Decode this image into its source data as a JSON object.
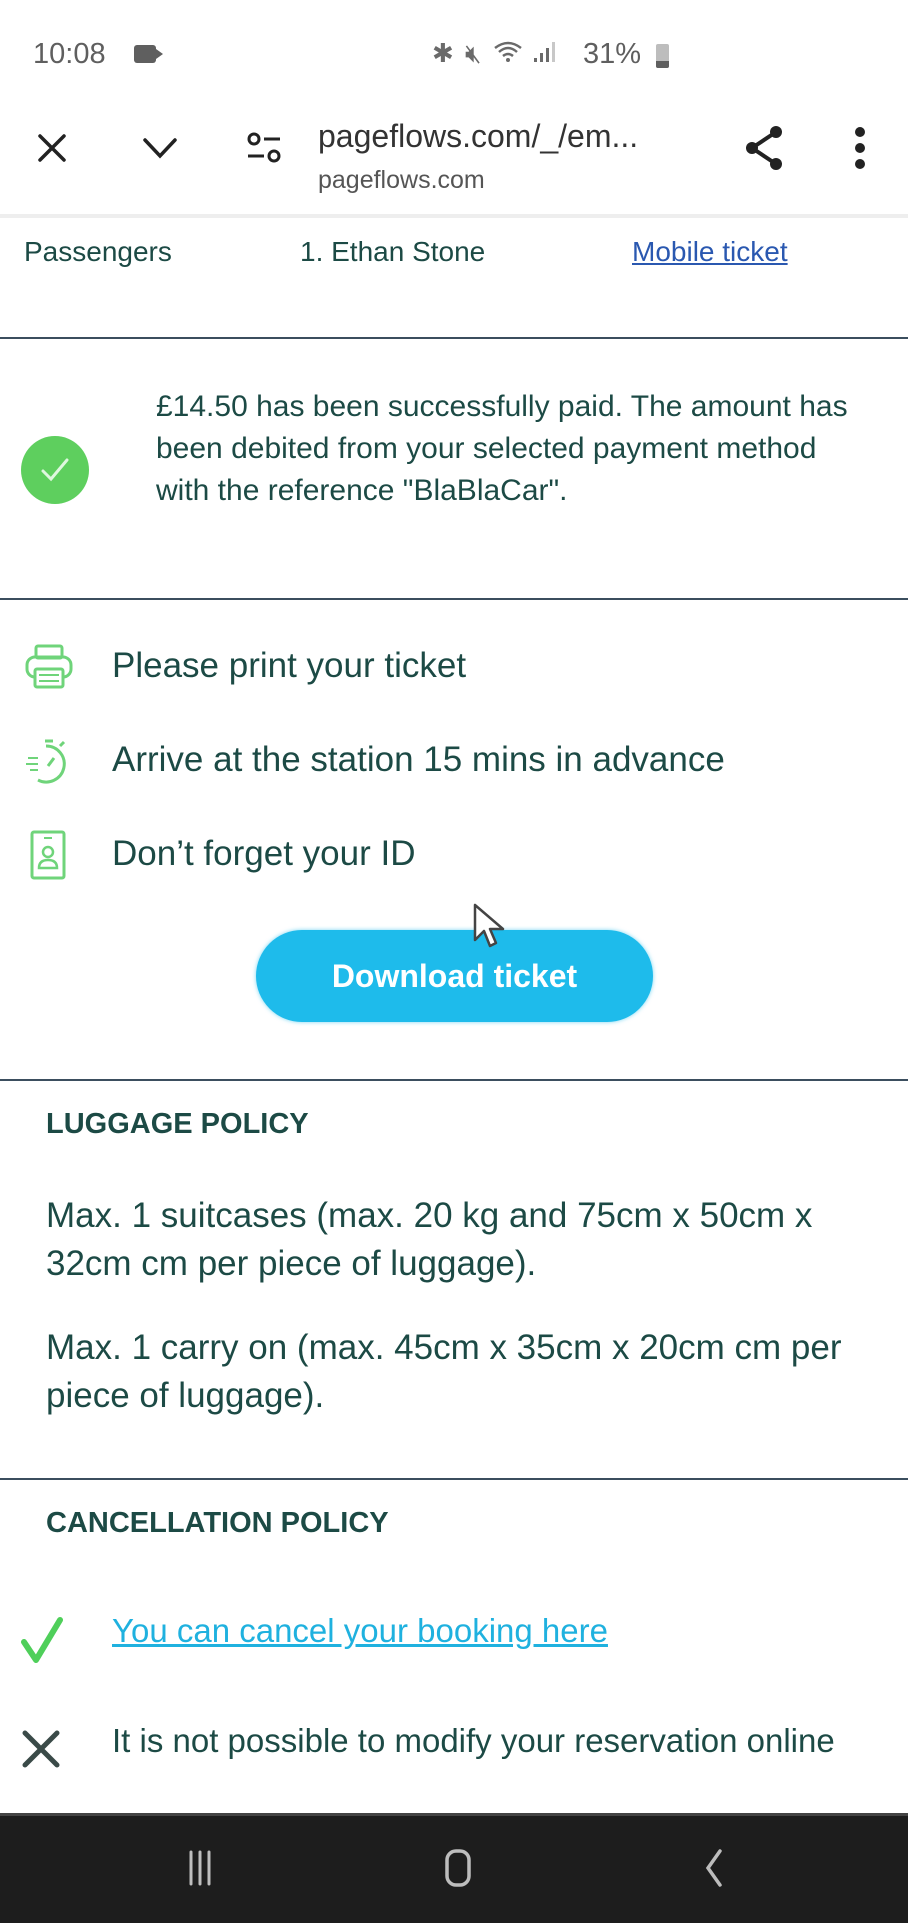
{
  "status_bar": {
    "time": "10:08",
    "icons": [
      "bluetooth-icon",
      "mute-icon",
      "wifi-icon",
      "signal-icon"
    ],
    "battery_text": "31%",
    "battery_level": 0.31
  },
  "browser": {
    "url": "pageflows.com/_/em...",
    "domain": "pageflows.com"
  },
  "passengers": {
    "label": "Passengers",
    "name": "1. Ethan Stone",
    "link": "Mobile ticket"
  },
  "payment": {
    "message": "£14.50 has been successfully paid. The amount has been debited from your selected payment method with the reference \"BlaBlaCar\"."
  },
  "reminders": [
    {
      "icon": "printer-icon",
      "text": "Please print your ticket"
    },
    {
      "icon": "stopwatch-icon",
      "text": "Arrive at the station 15 mins in advance"
    },
    {
      "icon": "id-card-icon",
      "text": "Don’t forget your ID"
    }
  ],
  "download_button": "Download ticket",
  "luggage": {
    "title": "LUGGAGE POLICY",
    "items": [
      "Max. 1 suitcases (max. 20 kg and 75cm x 50cm x 32cm cm per piece of luggage).",
      "Max. 1 carry on (max. 45cm x 35cm x 20cm cm per piece of luggage)."
    ]
  },
  "cancellation": {
    "title": "CANCELLATION POLICY",
    "cancel_link": "You can cancel your booking here",
    "modify_text": "It is not possible to modify your reservation online"
  },
  "colors": {
    "text": "#1c4a45",
    "accent": "#1ebbeb",
    "success": "#5ecf5e",
    "link": "#2a58b0"
  }
}
